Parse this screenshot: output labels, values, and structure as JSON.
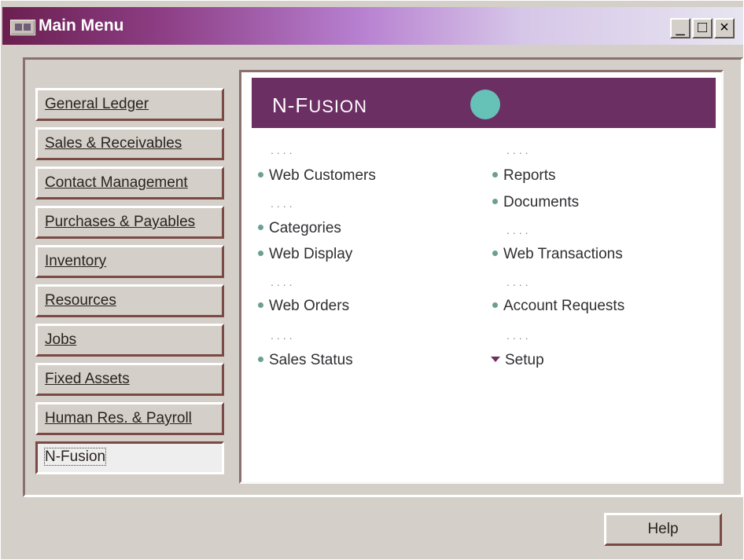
{
  "window": {
    "title": "Main Menu",
    "controls": {
      "minimize": "_",
      "maximize": "□",
      "close": "×"
    }
  },
  "modules": [
    {
      "label": "General Ledger"
    },
    {
      "label": "Sales & Receivables"
    },
    {
      "label": "Contact Management"
    },
    {
      "label": "Purchases & Payables"
    },
    {
      "label": "Inventory"
    },
    {
      "label": "Resources"
    },
    {
      "label": "Jobs"
    },
    {
      "label": "Fixed Assets"
    },
    {
      "label": "Human Res. & Payroll"
    },
    {
      "label": "N-Fusion",
      "selected": true
    }
  ],
  "panel": {
    "title": "N-Fusion",
    "title_caps": {
      "first": "N-F",
      "rest": "USION"
    },
    "separator": "....",
    "left_items": [
      "Web Customers",
      "Categories",
      "Web Display",
      "Web Orders",
      "Sales Status"
    ],
    "right_items": [
      "Reports",
      "Documents",
      "Web Transactions",
      "Account Requests",
      "Setup"
    ]
  },
  "footer": {
    "help_label": "Help"
  },
  "colors": {
    "accent": "#6c2f63",
    "bullet": "#6b9f92",
    "banner_dot": "#66c1b6",
    "window_bg": "#d4cfc8"
  },
  "icons": {
    "window_icon": "app-window-icon",
    "bullet_icon": "dot-bullet-icon",
    "setup_icon": "triangle-down-icon"
  }
}
